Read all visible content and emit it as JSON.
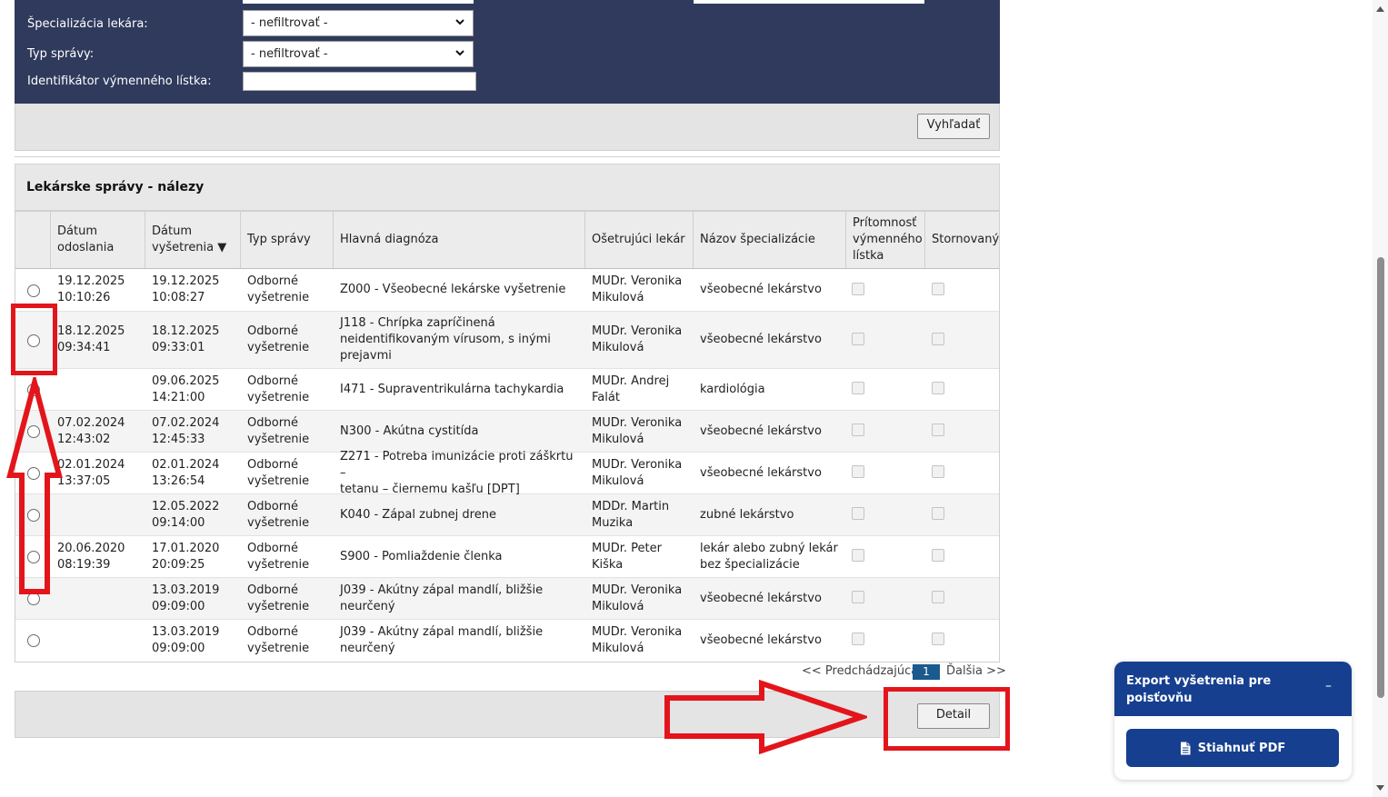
{
  "filters": {
    "specialization": {
      "label": "Špecializácia lekára:",
      "value": "- nefiltrovať -"
    },
    "report_type": {
      "label": "Typ správy:",
      "value": "- nefiltrovať -"
    },
    "slip_id": {
      "label": "Identifikátor výmenného lístka:",
      "value": ""
    },
    "search_button": "Vyhľadať"
  },
  "results": {
    "title": "Lekárske správy - nálezy",
    "columns": {
      "sent": [
        "Dátum",
        "odoslania"
      ],
      "exam": [
        "Dátum",
        "vyšetrenia"
      ],
      "sort_arrow": "▼",
      "type": "Typ správy",
      "diagnosis": "Hlavná diagnóza",
      "doctor": "Ošetrujúci lekár",
      "specialization": "Názov špecializácie",
      "slip": [
        "Prítomnosť",
        "výmenného",
        "lístka"
      ],
      "cancelled": "Stornovaný"
    },
    "rows": [
      {
        "sent": [
          "19.12.2025",
          "10:10:26"
        ],
        "exam": [
          "19.12.2025",
          "10:08:27"
        ],
        "type": [
          "Odborné",
          "vyšetrenie"
        ],
        "diagnosis": [
          "Z000 - Všeobecné lekárske vyšetrenie"
        ],
        "doctor": [
          "MUDr. Veronika",
          "Mikulová"
        ],
        "spec": [
          "všeobecné lekárstvo"
        ]
      },
      {
        "sent": [
          "18.12.2025",
          "09:34:41"
        ],
        "exam": [
          "18.12.2025",
          "09:33:01"
        ],
        "type": [
          "Odborné",
          "vyšetrenie"
        ],
        "diagnosis": [
          "J118 - Chrípka zapríčinená",
          "neidentifikovaným vírusom, s inými",
          "prejavmi"
        ],
        "doctor": [
          "MUDr. Veronika",
          "Mikulová"
        ],
        "spec": [
          "všeobecné lekárstvo"
        ]
      },
      {
        "sent": [],
        "exam": [
          "09.06.2025",
          "14:21:00"
        ],
        "type": [
          "Odborné",
          "vyšetrenie"
        ],
        "diagnosis": [
          "I471 - Supraventrikulárna tachykardia"
        ],
        "doctor": [
          "MUDr. Andrej",
          "Falát"
        ],
        "spec": [
          "kardiológia"
        ]
      },
      {
        "sent": [
          "07.02.2024",
          "12:43:02"
        ],
        "exam": [
          "07.02.2024",
          "12:45:33"
        ],
        "type": [
          "Odborné",
          "vyšetrenie"
        ],
        "diagnosis": [
          "N300 - Akútna cystitída"
        ],
        "doctor": [
          "MUDr. Veronika",
          "Mikulová"
        ],
        "spec": [
          "všeobecné lekárstvo"
        ]
      },
      {
        "sent": [
          "02.01.2024",
          "13:37:05"
        ],
        "exam": [
          "02.01.2024",
          "13:26:54"
        ],
        "type": [
          "Odborné",
          "vyšetrenie"
        ],
        "diagnosis": [
          "Z271 - Potreba imunizácie proti záškrtu –",
          "tetanu – čiernemu kašľu [DPT]"
        ],
        "doctor": [
          "MUDr. Veronika",
          "Mikulová"
        ],
        "spec": [
          "všeobecné lekárstvo"
        ]
      },
      {
        "sent": [],
        "exam": [
          "12.05.2022",
          "09:14:00"
        ],
        "type": [
          "Odborné",
          "vyšetrenie"
        ],
        "diagnosis": [
          "K040 - Zápal zubnej drene"
        ],
        "doctor": [
          "MDDr. Martin",
          "Muzika"
        ],
        "spec": [
          "zubné lekárstvo"
        ]
      },
      {
        "sent": [
          "20.06.2020",
          "08:19:39"
        ],
        "exam": [
          "17.01.2020",
          "20:09:25"
        ],
        "type": [
          "Odborné",
          "vyšetrenie"
        ],
        "diagnosis": [
          "S900 - Pomliaždenie členka"
        ],
        "doctor": [
          "MUDr. Peter",
          "Kiška"
        ],
        "spec": [
          "lekár alebo zubný lekár",
          "bez špecializácie"
        ]
      },
      {
        "sent": [],
        "exam": [
          "13.03.2019",
          "09:09:00"
        ],
        "type": [
          "Odborné",
          "vyšetrenie"
        ],
        "diagnosis": [
          "J039 - Akútny zápal mandlí, bližšie neurčený"
        ],
        "doctor": [
          "MUDr. Veronika",
          "Mikulová"
        ],
        "spec": [
          "všeobecné lekárstvo"
        ]
      },
      {
        "sent": [],
        "exam": [
          "13.03.2019",
          "09:09:00"
        ],
        "type": [
          "Odborné",
          "vyšetrenie"
        ],
        "diagnosis": [
          "J039 - Akútny zápal mandlí, bližšie neurčený"
        ],
        "doctor": [
          "MUDr. Veronika",
          "Mikulová"
        ],
        "spec": [
          "všeobecné lekárstvo"
        ]
      }
    ]
  },
  "pager": {
    "prev": "<< Predchádzajúca",
    "current": "1",
    "next": "Ďalšia >>"
  },
  "detail_button": "Detail",
  "export": {
    "title": "Export vyšetrenia pre poisťovňu",
    "minimize": "–",
    "download": "Stiahnuť PDF"
  },
  "colors": {
    "panel": "#2f3a5c",
    "accent": "#163f8f",
    "annotation": "#e3151b",
    "page_current": "#1a5a8e"
  },
  "icons": {
    "dropdown": "chevron-down-icon",
    "sort": "sort-desc-icon",
    "pdf": "document-icon"
  }
}
